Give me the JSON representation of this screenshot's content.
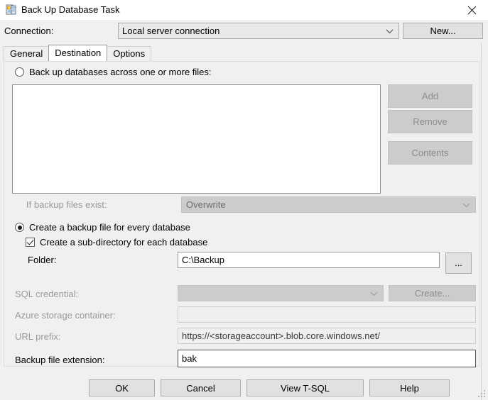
{
  "window": {
    "title": "Back Up Database Task",
    "icon": "database-task-icon",
    "close_label": "✕"
  },
  "connection": {
    "label": "Connection:",
    "value": "Local server connection",
    "new_button": "New..."
  },
  "tabs": [
    {
      "label": "General",
      "selected": false
    },
    {
      "label": "Destination",
      "selected": true
    },
    {
      "label": "Options",
      "selected": false
    }
  ],
  "destination": {
    "across_files_radio": "Back up databases across one or more files:",
    "side_buttons": [
      {
        "label": "Add"
      },
      {
        "label": "Remove"
      },
      {
        "label": "Contents"
      }
    ],
    "if_exists_label": "If backup files exist:",
    "if_exists_value": "Overwrite",
    "every_database_radio": "Create a backup file for every database",
    "sub_directory_checkbox": "Create a sub-directory for each database",
    "folder_label": "Folder:",
    "folder_value": "C:\\Backup",
    "browse_label": "...",
    "sql_credential_label": "SQL credential:",
    "sql_credential_value": "",
    "create_button": "Create...",
    "azure_container_label": "Azure storage container:",
    "azure_container_value": "",
    "url_prefix_label": "URL prefix:",
    "url_prefix_value": "https://<storageaccount>.blob.core.windows.net/",
    "extension_label": "Backup file extension:",
    "extension_value": "bak"
  },
  "footer": {
    "ok": "OK",
    "cancel": "Cancel",
    "view_tsql": "View T-SQL",
    "help": "Help"
  },
  "colors": {
    "dialog_background": "#f0f0f0",
    "titlebar_background": "#ffffff",
    "button_face": "#e1e1e1",
    "disabled_face": "#cccccc",
    "disabled_text": "#8d8d8d",
    "field_background": "#ffffff"
  }
}
